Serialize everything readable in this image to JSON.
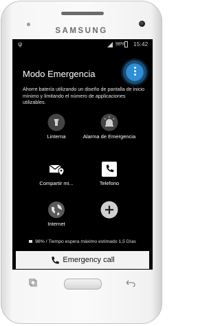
{
  "device": {
    "brand": "SAMSUNG"
  },
  "status_bar": {
    "battery_percent": "98%",
    "time": "15:42"
  },
  "header": {
    "title": "Modo Emergencia"
  },
  "description": "Ahorre batería utilizando un diseño de pantalla de inicio mínimo y limitando el número de applicaciones utilizables.",
  "apps": [
    {
      "label": "Linterna",
      "icon": "flashlight-icon"
    },
    {
      "label": "Alarma de Emergencia",
      "icon": "siren-icon"
    },
    {
      "label": "Compartir mi...",
      "icon": "share-location-icon"
    },
    {
      "label": "Telefono",
      "icon": "phone-icon"
    },
    {
      "label": "Internet",
      "icon": "globe-icon"
    },
    {
      "label": "",
      "icon": "add-icon"
    }
  ],
  "battery_estimate": "98% / Tiempo espera máximo estimado 1,5 Días",
  "emergency_call_label": "Emergency call",
  "colors": {
    "accent": "#2f8fd6",
    "screen_bg": "#000000"
  }
}
